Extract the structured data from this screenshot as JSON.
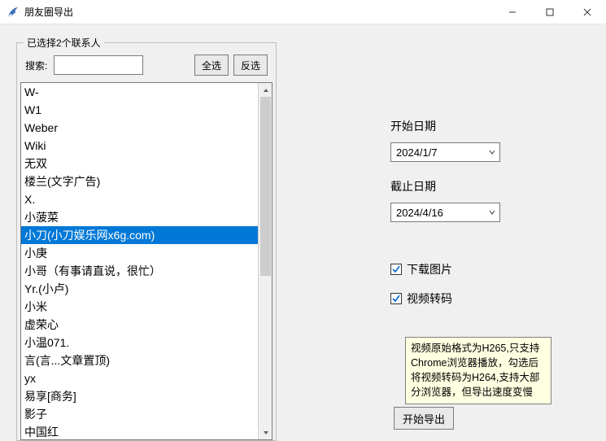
{
  "window": {
    "title": "朋友圈导出"
  },
  "group": {
    "legend": "已选择2个联系人",
    "search_label": "搜索:",
    "search_value": "",
    "select_all": "全选",
    "invert": "反选"
  },
  "contacts": [
    {
      "label": "W-",
      "selected": false
    },
    {
      "label": "W1",
      "selected": false
    },
    {
      "label": "Weber",
      "selected": false
    },
    {
      "label": "Wiki",
      "selected": false
    },
    {
      "label": "无双",
      "selected": false
    },
    {
      "label": "楼兰(文字广告)",
      "selected": false
    },
    {
      "label": "X.",
      "selected": false
    },
    {
      "label": "小菠菜",
      "selected": false
    },
    {
      "label": "小刀(小刀娱乐网x6g.com)",
      "selected": true
    },
    {
      "label": "小庚",
      "selected": false
    },
    {
      "label": "小哥（有事请直说，很忙）",
      "selected": false
    },
    {
      "label": "Yr.(小卢)",
      "selected": false
    },
    {
      "label": "小米",
      "selected": false
    },
    {
      "label": "虚荣心",
      "selected": false
    },
    {
      "label": "小温071.",
      "selected": false
    },
    {
      "label": "言(言...文章置顶)",
      "selected": false
    },
    {
      "label": "yx",
      "selected": false
    },
    {
      "label": "易享[商务]",
      "selected": false
    },
    {
      "label": "影子",
      "selected": false
    },
    {
      "label": "中国红",
      "selected": false
    }
  ],
  "right": {
    "start_label": "开始日期",
    "start_value": "2024/1/7",
    "end_label": "截止日期",
    "end_value": "2024/4/16",
    "download_images_label": "下载图片",
    "download_images_checked": true,
    "video_transcode_label": "视频转码",
    "video_transcode_checked": true,
    "tooltip": "视频原始格式为H265,只支持Chrome浏览器播放，勾选后将视频转码为H264,支持大部分浏览器，但导出速度变慢",
    "export_label": "开始导出"
  },
  "colors": {
    "selection": "#0078d7",
    "check": "#0066cc",
    "tooltip_bg": "#ffffe1"
  }
}
